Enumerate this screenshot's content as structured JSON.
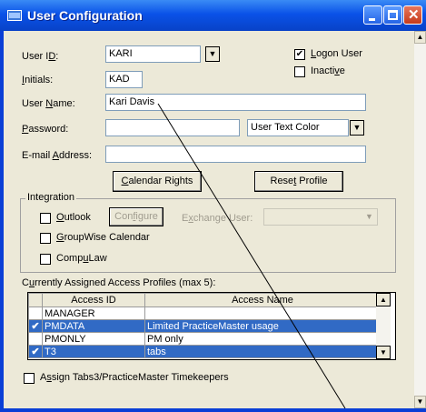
{
  "window": {
    "title": "User Configuration"
  },
  "form": {
    "user_id": {
      "label_pre": "User I",
      "label_ul": "D",
      "label_post": ":",
      "value": "KARI"
    },
    "initials": {
      "label_ul": "I",
      "label_post": "nitials:",
      "value": "KAD"
    },
    "user_name": {
      "label_pre": "User ",
      "label_ul": "N",
      "label_post": "ame:",
      "value": "Kari Davis"
    },
    "password": {
      "label_ul": "P",
      "label_post": "assword:",
      "value": ""
    },
    "email": {
      "label_pre": "E-mail ",
      "label_ul": "A",
      "label_post": "ddress:",
      "value": ""
    },
    "text_color": {
      "value": "User Text Color"
    },
    "logon_user": {
      "label_ul": "L",
      "label_post": "ogon User",
      "checked": true,
      "check_glyph": "✔"
    },
    "inactive": {
      "label_pre": "Inacti",
      "label_ul": "v",
      "label_post": "e",
      "checked": false
    },
    "calendar_rights": {
      "label_ul": "C",
      "label_post": "alendar Rights"
    },
    "reset_profile": {
      "label_pre": "Rese",
      "label_ul": "t",
      "label_post": " Profile"
    }
  },
  "integration": {
    "title": "Integration",
    "outlook": {
      "label_ul": "O",
      "label_post": "utlook",
      "checked": false
    },
    "configure": {
      "label_pre": "Con",
      "label_ul": "f",
      "label_post": "igure"
    },
    "exchange_user": {
      "label_pre": "E",
      "label_ul": "x",
      "label_post": "change User:",
      "value": ""
    },
    "groupwise": {
      "label_ul": "G",
      "label_post": "roupWise Calendar",
      "checked": false
    },
    "compulaw": {
      "label_pre": "Comp",
      "label_ul": "u",
      "label_post": "Law",
      "checked": false
    }
  },
  "profiles": {
    "title_pre": "C",
    "title_ul": "u",
    "title_post": "rrently Assigned Access Profiles (max 5):",
    "columns": [
      "Access ID",
      "Access Name"
    ],
    "rows": [
      {
        "check": "",
        "id": "MANAGER",
        "name": ""
      },
      {
        "check": "✔",
        "id": "PMDATA",
        "name": "Limited PracticeMaster usage"
      },
      {
        "check": "",
        "id": "PMONLY",
        "name": "PM only"
      },
      {
        "check": "✔",
        "id": "T3",
        "name": "tabs"
      }
    ]
  },
  "assign_tabs3": {
    "label_pre": "A",
    "label_ul": "s",
    "label_post": "sign Tabs3/PracticeMaster Timekeepers",
    "checked": false
  },
  "accent": {
    "titlebar": "#0a52e8",
    "selection": "#316ac5"
  }
}
